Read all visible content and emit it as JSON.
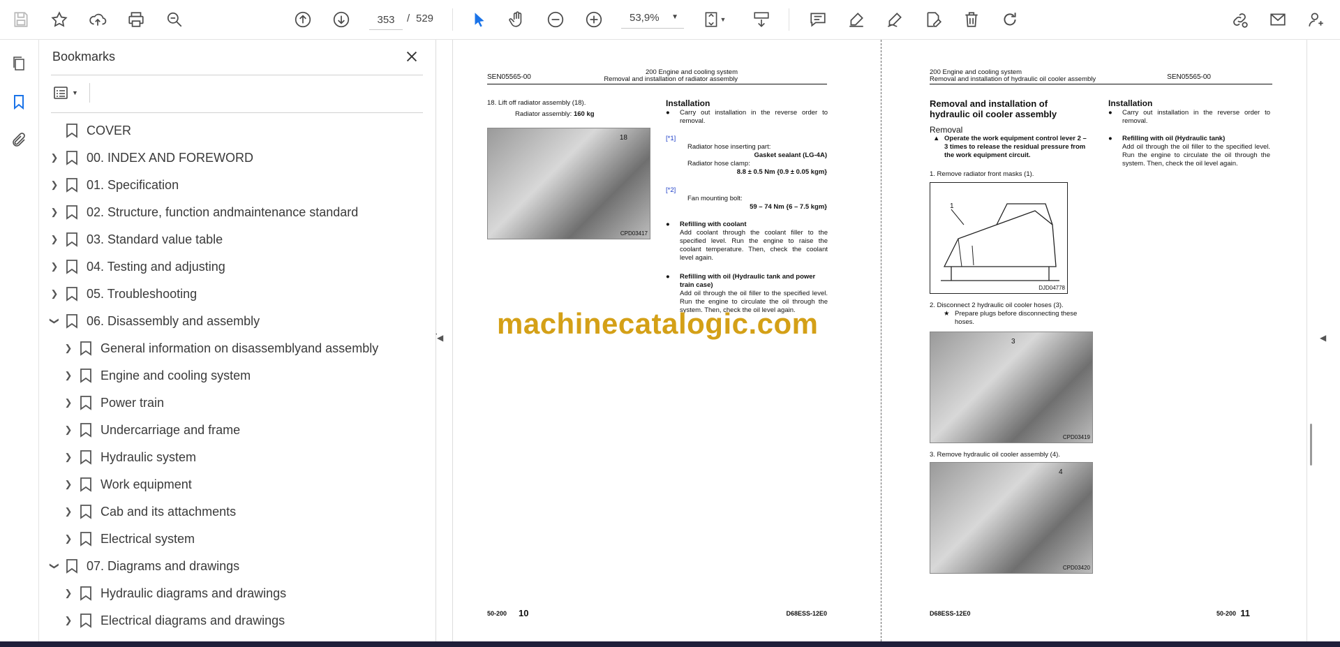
{
  "toolbar": {
    "page_current": "353",
    "page_sep": "/",
    "page_total": "529",
    "zoom": "53,9%"
  },
  "bookmarks_panel": {
    "title": "Bookmarks",
    "items": [
      {
        "label": "COVER"
      },
      {
        "label": "00. INDEX AND FOREWORD"
      },
      {
        "label": "01. Specification"
      },
      {
        "label": "02. Structure, function andmaintenance standard"
      },
      {
        "label": "03. Standard value table"
      },
      {
        "label": "04. Testing and adjusting"
      },
      {
        "label": "05. Troubleshooting"
      },
      {
        "label": "06. Disassembly and assembly"
      },
      {
        "label": "General information on disassemblyand assembly"
      },
      {
        "label": "Engine and cooling system"
      },
      {
        "label": "Power train"
      },
      {
        "label": "Undercarriage and frame"
      },
      {
        "label": "Hydraulic system"
      },
      {
        "label": "Work equipment"
      },
      {
        "label": "Cab and its attachments"
      },
      {
        "label": "Electrical system"
      },
      {
        "label": "07. Diagrams and drawings"
      },
      {
        "label": "Hydraulic diagrams and drawings"
      },
      {
        "label": "Electrical diagrams and drawings"
      }
    ]
  },
  "left_page": {
    "doc_id": "SEN05565-00",
    "header_line1": "200 Engine and cooling system",
    "header_line2": "Removal and installation of radiator assembly",
    "step18": "18.  Lift off radiator assembly (18).",
    "step18_weight_label": "Radiator assembly:",
    "step18_weight": "160 kg",
    "photo1_callout": "18",
    "photo1_caption": "CPD03417",
    "install_title": "Installation",
    "install_b1": "Carry out installation in the reverse order to removal.",
    "ref1": "[*1]",
    "ref1_line1": "Radiator hose inserting part:",
    "ref1_line1_val": "Gasket sealant (LG-4A)",
    "ref1_line2": "Radiator hose clamp:",
    "ref1_line2_val": "8.8 ± 0.5 Nm {0.9 ± 0.05 kgm}",
    "ref2": "[*2]",
    "ref2_line1": "Fan mounting bolt:",
    "ref2_line1_val": "59 – 74 Nm {6 – 7.5 kgm}",
    "coolant_title": "Refilling with coolant",
    "coolant_text": "Add coolant through the coolant filler to the specified level. Run the engine to raise the coolant temperature. Then, check the coolant level again.",
    "oil_title": "Refilling with oil (Hydraulic tank and power train case)",
    "oil_text": "Add oil through the oil filler to the specified level. Run the engine to circulate the oil through the system. Then, check the oil level again.",
    "footer_left": "50-200",
    "footer_num": "10",
    "footer_right": "D68ESS-12E0"
  },
  "watermark": "machinecatalogic.com",
  "right_page": {
    "doc_id": "SEN05565-00",
    "header_line1": "200 Engine and cooling system",
    "header_line2": "Removal and installation of hydraulic oil cooler assembly",
    "main_title": "Removal and installation of hydraulic oil cooler assembly",
    "removal_title": "Removal",
    "warning": "Operate the work equipment control lever 2 – 3 times to release the residual pressure from the work equipment circuit.",
    "step1": "1.    Remove radiator front masks (1).",
    "drawing_callout": "1",
    "drawing_caption": "DJD04778",
    "step2": "2.    Disconnect 2 hydraulic oil cooler hoses (3).",
    "step2_note": "Prepare plugs before disconnecting these hoses.",
    "photo2_callout": "3",
    "photo2_caption": "CPD03419",
    "step3": "3.    Remove hydraulic oil cooler assembly (4).",
    "photo3_callout": "4",
    "photo3_caption": "CPD03420",
    "install_title": "Installation",
    "install_b1": "Carry out installation in the reverse order to removal.",
    "oil_title": "Refilling with oil (Hydraulic tank)",
    "oil_text": "Add oil through the oil filler to the specified level. Run the engine to circulate the oil through the system. Then, check the oil level again.",
    "footer_left": "D68ESS-12E0",
    "footer_code": "50-200",
    "footer_num": "11"
  }
}
